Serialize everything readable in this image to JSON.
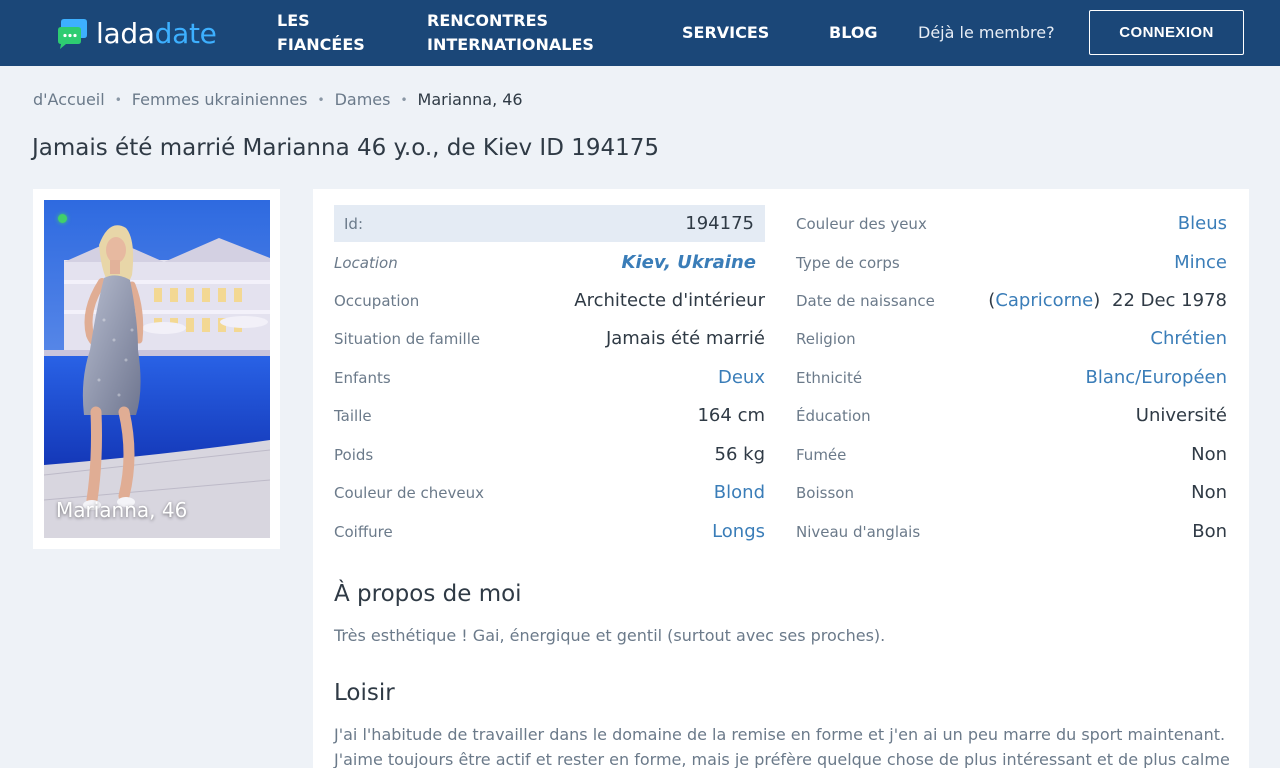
{
  "header": {
    "logo": {
      "part1": "lada",
      "part2": "date"
    },
    "nav": {
      "fiancees_line1": "LES",
      "fiancees_line2": "FIANCÉES",
      "international_line1": "RENCONTRES",
      "international_line2": "INTERNATIONALES",
      "services": "SERVICES",
      "blog": "BLOG"
    },
    "member_text": "Déjà le membre?",
    "login_button": "CONNEXION"
  },
  "breadcrumb": {
    "home": "d'Accueil",
    "category": "Femmes ukrainiennes",
    "section": "Dames",
    "current": "Marianna, 46",
    "separator": "•"
  },
  "page_title": "Jamais été marrié Marianna 46 y.o., de Kiev ID 194175",
  "photo": {
    "caption": "Marianna, 46",
    "online": true
  },
  "profile": {
    "left": {
      "id": {
        "label": "Id:",
        "value": "194175"
      },
      "location": {
        "label": "Location",
        "value": "Kiev, Ukraine"
      },
      "occupation": {
        "label": "Occupation",
        "value": "Architecte d'intérieur"
      },
      "marital": {
        "label": "Situation de famille",
        "value": "Jamais été marrié"
      },
      "children": {
        "label": "Enfants",
        "value": "Deux"
      },
      "height": {
        "label": "Taille",
        "value": "164 cm"
      },
      "weight": {
        "label": "Poids",
        "value": "56 kg"
      },
      "hair_color": {
        "label": "Couleur de cheveux",
        "value": "Blond"
      },
      "hairstyle": {
        "label": "Coiffure",
        "value": "Longs"
      }
    },
    "right": {
      "eyes": {
        "label": "Couleur des yeux",
        "value": "Bleus"
      },
      "body": {
        "label": "Type de corps",
        "value": "Mince"
      },
      "birth": {
        "label": "Date de naissance",
        "zodiac": "Capricorne",
        "open": "(",
        "close": ")",
        "date": "22 Dec 1978"
      },
      "religion": {
        "label": "Religion",
        "value": "Chrétien"
      },
      "ethnicity": {
        "label": "Ethnicité",
        "value": "Blanc/Européen"
      },
      "education": {
        "label": "Éducation",
        "value": "Université"
      },
      "smoking": {
        "label": "Fumée",
        "value": "Non"
      },
      "drinking": {
        "label": "Boisson",
        "value": "Non"
      },
      "english": {
        "label": "Niveau d'anglais",
        "value": "Bon"
      }
    }
  },
  "about": {
    "title": "À propos de moi",
    "text": "Très esthétique ! Gai, énergique et gentil (surtout avec ses proches)."
  },
  "hobby": {
    "title": "Loisir",
    "line1": "J'ai l'habitude de travailler dans le domaine de la remise en forme et j'en ai un peu marre du sport maintenant.",
    "line2": "J'aime toujours être actif et rester en forme, mais je préfère quelque chose de plus intéressant et de plus calme"
  },
  "colors": {
    "header_bg": "#1b4778",
    "logo_accent": "#3db0ff",
    "link": "#3a7db8",
    "page_bg": "#eef2f7",
    "online": "#41d06a"
  }
}
